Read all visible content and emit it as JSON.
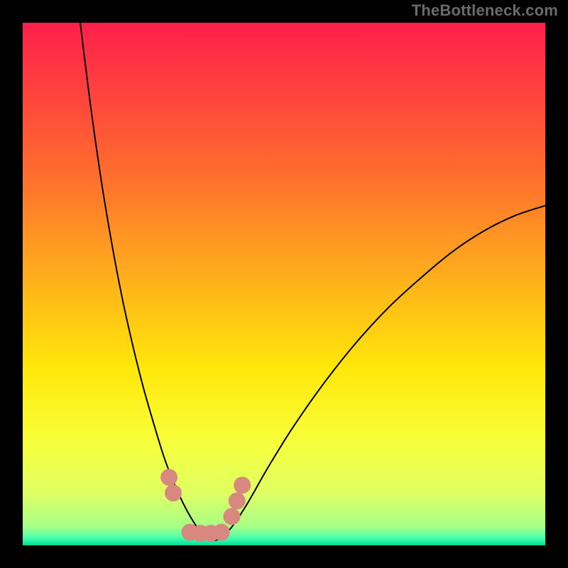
{
  "watermark": "TheBottleneck.com",
  "chart_data": {
    "type": "line",
    "title": "",
    "xlabel": "",
    "ylabel": "",
    "xlim": [
      0,
      100
    ],
    "ylim": [
      0,
      100
    ],
    "grid": false,
    "legend": false,
    "background_gradient": {
      "stops": [
        {
          "offset": 0.0,
          "color": "#ff1f4b"
        },
        {
          "offset": 0.28,
          "color": "#ff6a2f"
        },
        {
          "offset": 0.5,
          "color": "#ffb31a"
        },
        {
          "offset": 0.66,
          "color": "#ffe70a"
        },
        {
          "offset": 0.8,
          "color": "#f7ff3a"
        },
        {
          "offset": 0.9,
          "color": "#dfff63"
        },
        {
          "offset": 0.965,
          "color": "#a6ff87"
        },
        {
          "offset": 0.985,
          "color": "#4dffad"
        },
        {
          "offset": 1.0,
          "color": "#00e19b"
        }
      ]
    },
    "series": [
      {
        "name": "bottleneck-curve",
        "color": "#000000",
        "width": 2,
        "x": [
          11.0,
          13.0,
          15.0,
          17.0,
          19.0,
          21.0,
          23.0,
          25.0,
          27.0,
          28.5,
          30.0,
          31.5,
          33.0,
          34.5,
          36.0,
          37.0,
          38.0,
          40.0,
          43.0,
          47.0,
          52.0,
          58.0,
          64.0,
          70.0,
          76.0,
          82.0,
          88.0,
          94.0,
          100.0
        ],
        "y": [
          100.0,
          84.0,
          70.0,
          58.0,
          47.5,
          38.5,
          30.5,
          23.5,
          17.0,
          13.0,
          9.5,
          6.5,
          4.0,
          2.0,
          1.0,
          1.0,
          1.5,
          3.5,
          8.0,
          15.0,
          23.0,
          31.5,
          39.0,
          45.5,
          51.0,
          56.0,
          60.0,
          63.0,
          65.0
        ]
      }
    ],
    "markers": {
      "name": "optimal-range-markers",
      "color": "#d98880",
      "radius": 12,
      "points": [
        {
          "x": 28.0,
          "y": 13.0
        },
        {
          "x": 28.8,
          "y": 10.0
        },
        {
          "x": 32.0,
          "y": 2.5
        },
        {
          "x": 34.0,
          "y": 2.3
        },
        {
          "x": 36.0,
          "y": 2.3
        },
        {
          "x": 38.0,
          "y": 2.5
        },
        {
          "x": 40.0,
          "y": 5.5
        },
        {
          "x": 41.0,
          "y": 8.5
        },
        {
          "x": 42.0,
          "y": 11.5
        }
      ]
    }
  }
}
